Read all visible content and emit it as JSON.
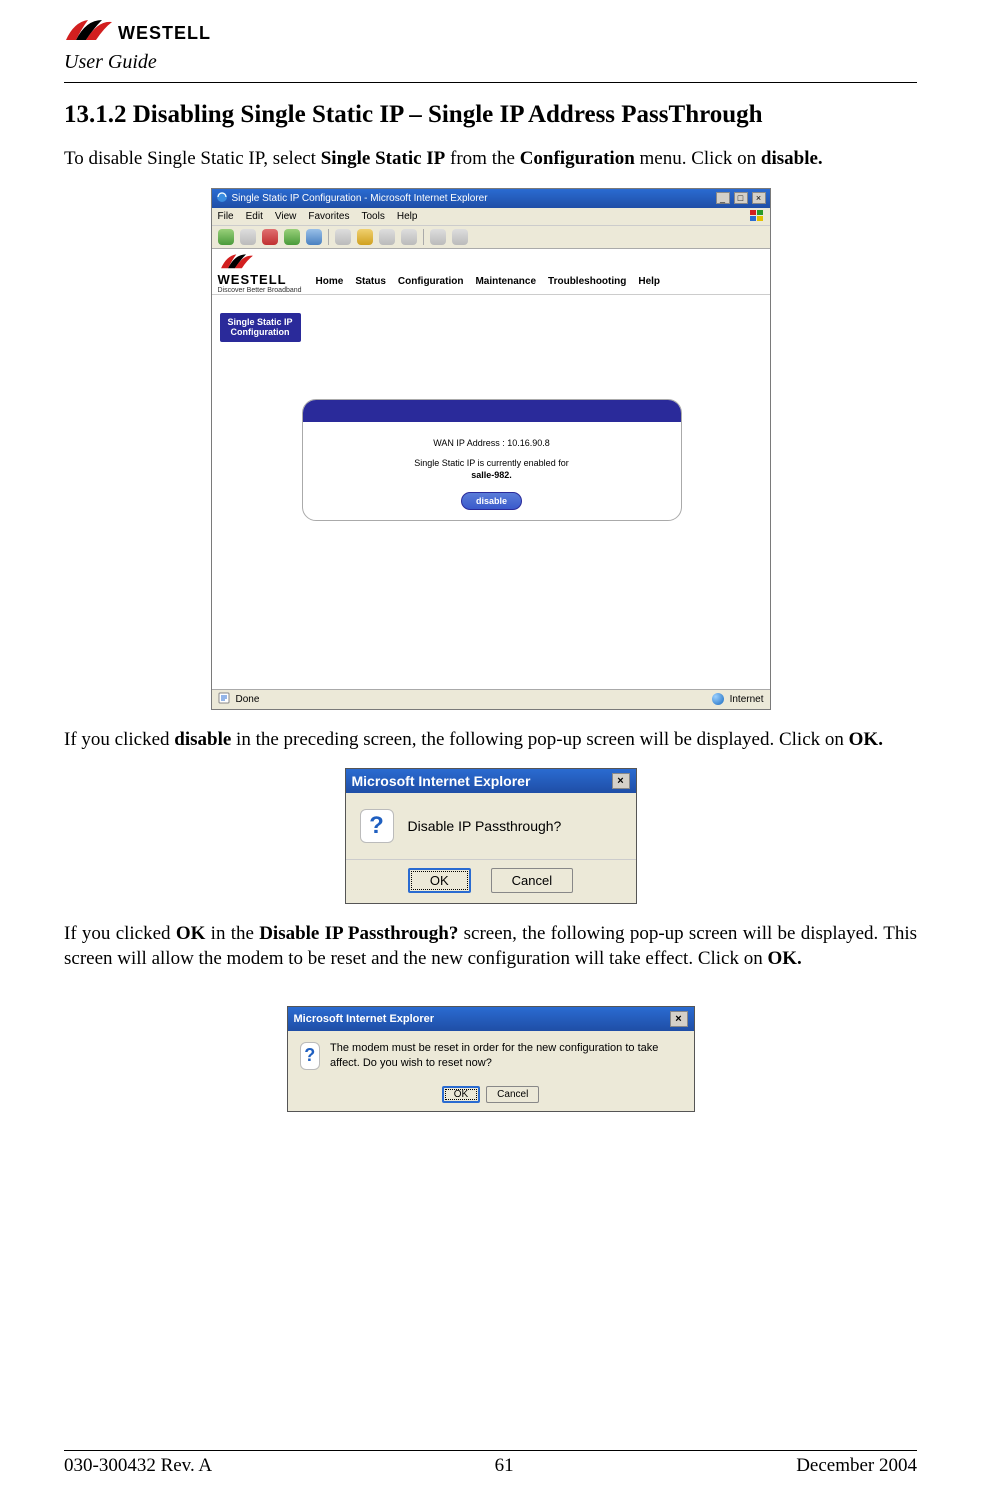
{
  "header": {
    "logo_text": "WESTELL",
    "user_guide": "User Guide"
  },
  "section": {
    "title": "13.1.2  Disabling Single Static IP – Single IP Address PassThrough"
  },
  "para1": {
    "pre1": "To disable Single Static IP, select ",
    "b1": "Single Static IP",
    "mid1": " from the ",
    "b2": "Configuration",
    "mid2": " menu. Click on ",
    "b3": "disable."
  },
  "ie": {
    "title": "Single Static IP Configuration - Microsoft Internet Explorer",
    "menus": [
      "File",
      "Edit",
      "View",
      "Favorites",
      "Tools",
      "Help"
    ],
    "brand": {
      "text": "WESTELL",
      "tagline": "Discover Better Broadband"
    },
    "nav": [
      "Home",
      "Status",
      "Configuration",
      "Maintenance",
      "Troubleshooting",
      "Help"
    ],
    "side_tab": "Single Static IP\nConfiguration",
    "panel": {
      "wan_label": "WAN IP Address :",
      "wan_value": "10.16.90.8",
      "enabled_text": "Single Static IP is currently enabled for",
      "hostname": "salle-982.",
      "button": "disable"
    },
    "status": {
      "done": "Done",
      "zone": "Internet"
    }
  },
  "para2": {
    "pre": "If you clicked ",
    "b": "disable",
    "mid": " in the preceding screen, the following pop-up screen will be displayed. Click on ",
    "b2": "OK."
  },
  "dialog1": {
    "title": "Microsoft Internet Explorer",
    "text": "Disable IP Passthrough?",
    "ok": "OK",
    "cancel": "Cancel"
  },
  "para3": {
    "pre": "If you clicked ",
    "b1": "OK",
    "mid1": " in the ",
    "b2": "Disable IP Passthrough?",
    "mid2": " screen, the following pop-up screen will be displayed. This screen will allow the modem to be reset and the new configuration will take effect. Click on ",
    "b3": "OK."
  },
  "dialog2": {
    "title": "Microsoft Internet Explorer",
    "text": "The modem must be reset in order for the new configuration to take affect. Do you wish to reset now?",
    "ok": "OK",
    "cancel": "Cancel"
  },
  "footer": {
    "left": "030-300432 Rev. A",
    "center": "61",
    "right": "December 2004"
  }
}
